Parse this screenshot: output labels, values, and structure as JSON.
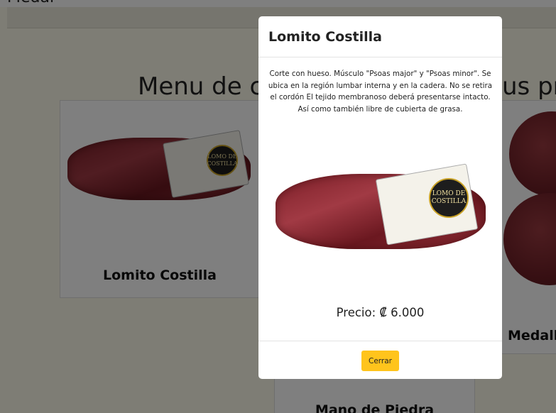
{
  "page": {
    "top_text": "Medal",
    "menu_title_left": "Menu de c",
    "menu_title_right": "us pre",
    "cards": [
      {
        "title": "Lomito Costilla"
      },
      {
        "title": "Medall"
      },
      {
        "title": "Mano de Piedra"
      }
    ]
  },
  "product_label": {
    "badge_text": "LOMO DE COSTILLA"
  },
  "modal": {
    "title": "Lomito Costilla",
    "description": "Corte con hueso. Músculo \"Psoas major\" y \"Psoas minor\". Se ubica en la región lumbar interna y en la cadera. No se retira el cordón El tejido membranoso deberá presentarse intacto. Así como también libre de cubierta de grasa.",
    "price": "Precio: ₡ 6.000",
    "close_label": "Cerrar"
  },
  "colors": {
    "page_background": "#fcfbea",
    "button_yellow": "#ffc41c",
    "backdrop": "rgba(0,0,0,0.5)"
  }
}
